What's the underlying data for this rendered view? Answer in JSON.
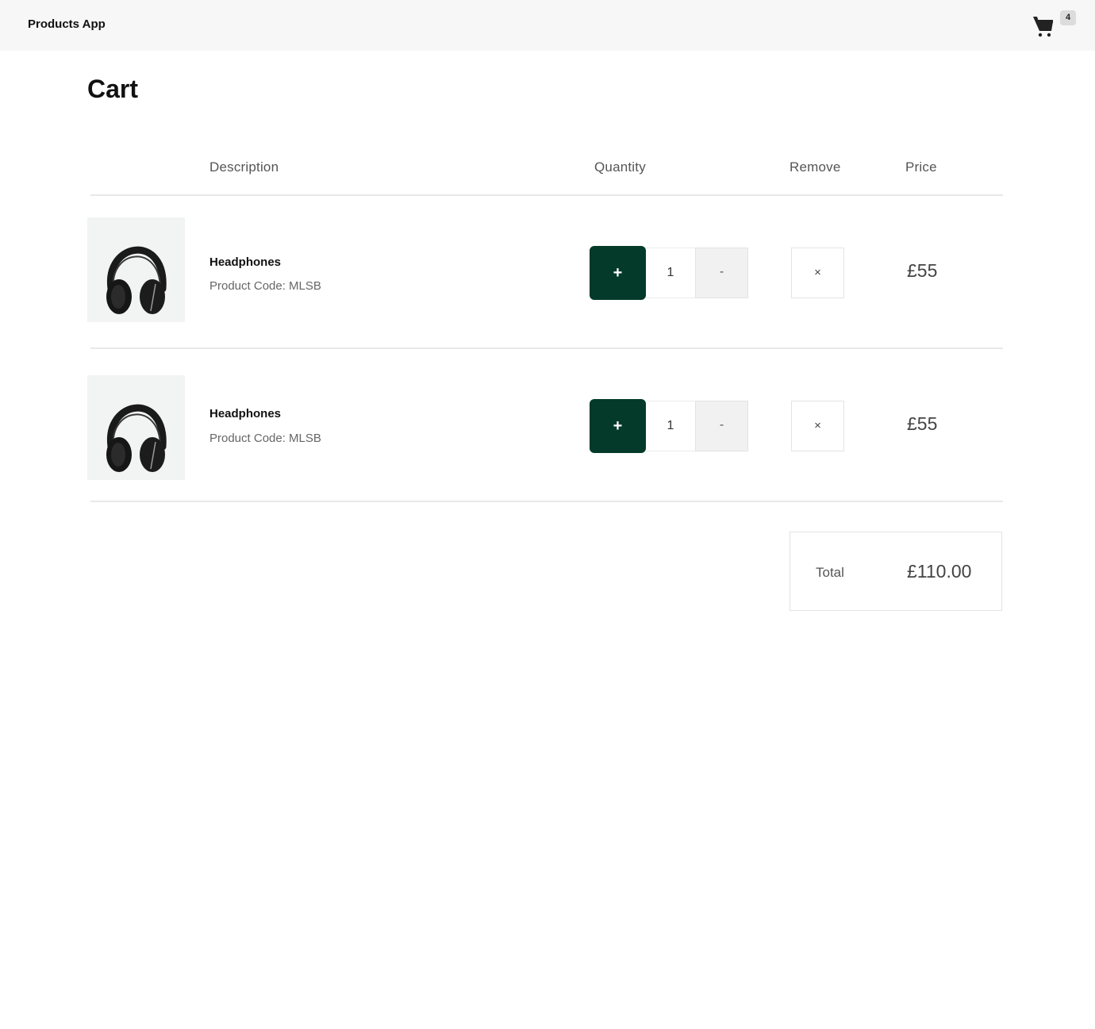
{
  "header": {
    "app_title": "Products App",
    "cart_icon": "shopping-cart-icon",
    "cart_count": "4"
  },
  "page": {
    "title": "Cart"
  },
  "table": {
    "columns": [
      "Description",
      "Quantity",
      "Remove",
      "Price"
    ],
    "rows": [
      {
        "image": "headphones-image",
        "name": "Headphones",
        "code": "Product Code: MLSB",
        "increment_label": "+",
        "quantity": "1",
        "decrement_label": "-",
        "remove_label": "×",
        "price": "£55"
      },
      {
        "image": "headphones-image",
        "name": "Headphones",
        "code": "Product Code: MLSB",
        "increment_label": "+",
        "quantity": "1",
        "decrement_label": "-",
        "remove_label": "×",
        "price": "£55"
      }
    ]
  },
  "summary": {
    "total_label": "Total",
    "total_value": "£110.00"
  },
  "colors": {
    "accent": "#033a2a",
    "topbar": "#f7f7f7"
  }
}
